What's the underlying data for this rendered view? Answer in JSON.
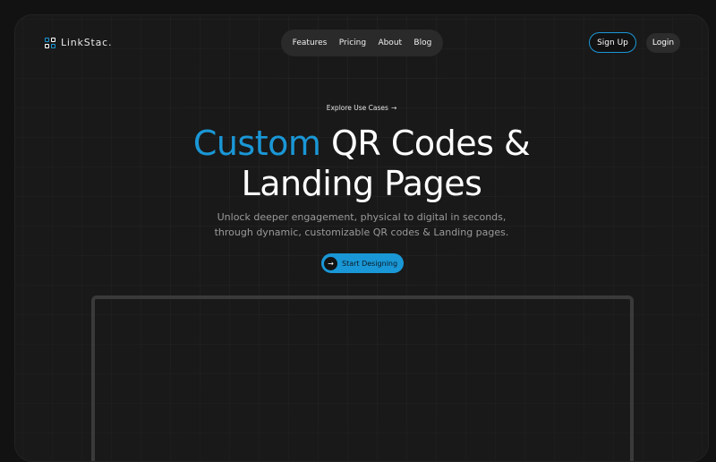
{
  "brand": {
    "name": "LinkStac.",
    "icon": "qr-grid-icon",
    "accent": "#1a97d6"
  },
  "nav": {
    "items": [
      {
        "label": "Features"
      },
      {
        "label": "Pricing"
      },
      {
        "label": "About"
      },
      {
        "label": "Blog"
      }
    ]
  },
  "auth": {
    "signup_label": "Sign Up",
    "login_label": "Login"
  },
  "hero": {
    "explore_label": "Explore Use Cases",
    "explore_icon": "arrow-right-icon",
    "headline_accent": "Custom",
    "headline_rest": " QR Codes &",
    "headline_line2": "Landing Pages",
    "subtitle_line1": "Unlock deeper engagement, physical to digital in seconds,",
    "subtitle_line2": "through dynamic, customizable QR codes & Landing pages.",
    "cta_label": "Start Designing",
    "cta_icon": "arrow-right-circle-icon"
  }
}
